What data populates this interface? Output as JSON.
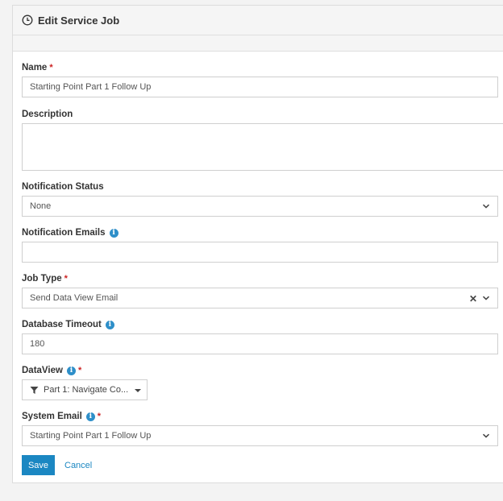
{
  "header": {
    "title": "Edit Service Job",
    "icon": "clock-icon"
  },
  "form": {
    "name": {
      "label": "Name",
      "required": "*",
      "value": "Starting Point Part 1 Follow Up"
    },
    "description": {
      "label": "Description",
      "value": ""
    },
    "notification_status": {
      "label": "Notification Status",
      "value": "None"
    },
    "notification_emails": {
      "label": "Notification Emails",
      "info": "i",
      "value": ""
    },
    "job_type": {
      "label": "Job Type",
      "required": "*",
      "value": "Send Data View Email",
      "clear": "✕"
    },
    "database_timeout": {
      "label": "Database Timeout",
      "info": "i",
      "value": "180"
    },
    "dataview": {
      "label": "DataView",
      "info": "i",
      "required": "*",
      "value": "Part 1: Navigate Co..."
    },
    "system_email": {
      "label": "System Email",
      "info": "i",
      "required": "*",
      "value": "Starting Point Part 1 Follow Up"
    }
  },
  "actions": {
    "save": "Save",
    "cancel": "Cancel"
  },
  "colors": {
    "primary": "#1b87c2",
    "required": "#cc2222",
    "info": "#2e8fc9"
  }
}
